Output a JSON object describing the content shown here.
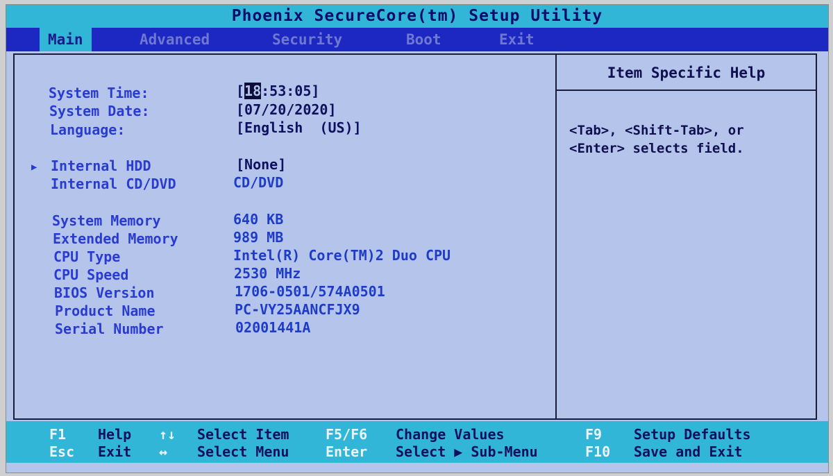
{
  "title": "Phoenix SecureCore(tm) Setup Utility",
  "tabs": [
    {
      "label": "Main",
      "active": true
    },
    {
      "label": "Advanced",
      "active": false
    },
    {
      "label": "Security",
      "active": false
    },
    {
      "label": "Boot",
      "active": false
    },
    {
      "label": "Exit",
      "active": false
    }
  ],
  "settings": {
    "system_time": {
      "label": "System Time:",
      "value_prefix": "[",
      "value_cursor": "18",
      "value_rest": ":53:05]"
    },
    "system_date": {
      "label": "System Date:",
      "value": "[07/20/2020]"
    },
    "language": {
      "label": "Language:",
      "value": "[English  (US)]"
    },
    "internal_hdd": {
      "label": "Internal HDD",
      "value": "[None]",
      "arrow": "▶"
    },
    "internal_cd": {
      "label": "Internal CD/DVD",
      "value": "CD/DVD"
    },
    "system_memory": {
      "label": "System Memory",
      "value": "640 KB"
    },
    "extended_memory": {
      "label": "Extended Memory",
      "value": "989 MB"
    },
    "cpu_type": {
      "label": "CPU Type",
      "value": "Intel(R) Core(TM)2 Duo CPU"
    },
    "cpu_speed": {
      "label": "CPU Speed",
      "value": "2530 MHz"
    },
    "bios_version": {
      "label": "BIOS Version",
      "value": "1706-0501/574A0501"
    },
    "product_name": {
      "label": "Product Name",
      "value": "PC-VY25AANCFJX9"
    },
    "serial_number": {
      "label": "Serial Number",
      "value": "02001441A"
    }
  },
  "help": {
    "title": "Item Specific Help",
    "text": "<Tab>, <Shift-Tab>, or\n<Enter> selects field."
  },
  "footer": {
    "f1": {
      "key": "F1",
      "desc": "Help"
    },
    "updown": {
      "key": "↑↓",
      "desc": "Select Item"
    },
    "f5f6": {
      "key": "F5/F6",
      "desc": "Change Values"
    },
    "f9": {
      "key": "F9",
      "desc": "Setup Defaults"
    },
    "esc": {
      "key": "Esc",
      "desc": "Exit"
    },
    "leftright": {
      "key": "↔",
      "desc": "Select Menu"
    },
    "enter": {
      "key": "Enter",
      "desc": "Select ▶ Sub-Menu"
    },
    "f10": {
      "key": "F10",
      "desc": "Save and Exit"
    }
  },
  "colors": {
    "background": "#b4c4ea",
    "title_bar": "#32b6d8",
    "menu_bar": "#1d27c2",
    "label": "#2a3cd0",
    "value": "#101060"
  }
}
